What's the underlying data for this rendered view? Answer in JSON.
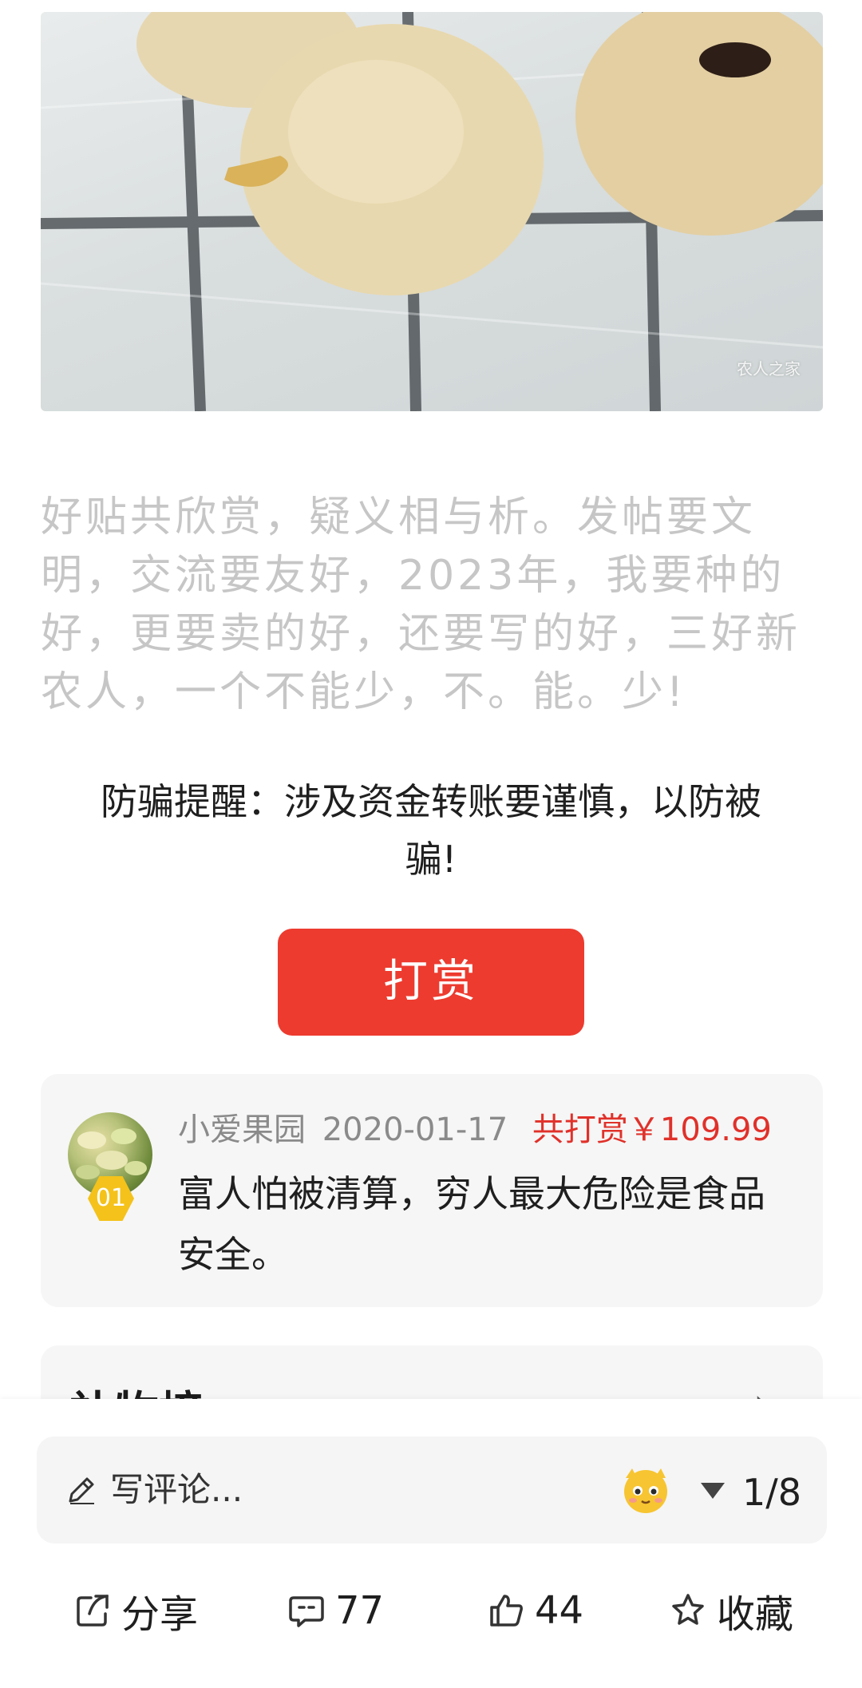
{
  "photo": {
    "alt_icon": "fig-photo",
    "watermark": "农人之家"
  },
  "post": {
    "text": "好贴共欣赏，疑义相与析。发帖要文明，交流要友好，2023年，我要种的好，更要卖的好，还要写的好，三好新农人，一个不能少，不。能。少!"
  },
  "warning": {
    "text": "防骗提醒：涉及资金转账要谨慎，以防被骗!"
  },
  "tip_button": {
    "label": "打赏"
  },
  "reward": {
    "user": "小爱果园",
    "date": "2020-01-17",
    "total": "共打赏￥109.99",
    "rank": "01",
    "comment": "富人怕被清算，穷人最大危险是食品安全。"
  },
  "next_section": {
    "title": "补物榜",
    "chevron": "›"
  },
  "comment_bar": {
    "placeholder": "写评论...",
    "page_indicator": "1/8"
  },
  "actions": {
    "share_label": "分享",
    "comments_count": "77",
    "likes_count": "44",
    "favorite_label": "收藏"
  },
  "colors": {
    "accent_red": "#ed3b2f",
    "badge_yellow": "#f4c21b",
    "muted_text": "#c6c6c6"
  }
}
